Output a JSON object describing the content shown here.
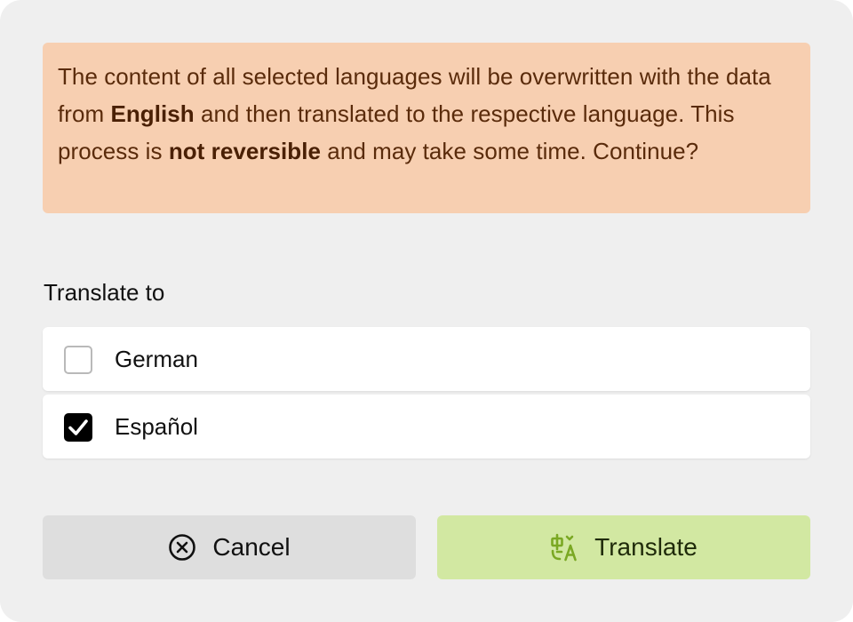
{
  "notice": {
    "part1": "The content of all selected languages will be overwritten with the data from ",
    "source_language": "English",
    "part2": " and then translated to the respective language. This process is ",
    "emphasis": "not reversible",
    "part3": " and may take some time. Continue?"
  },
  "translate_to": {
    "label": "Translate to",
    "languages": [
      {
        "label": "German",
        "checked": false
      },
      {
        "label": "Español",
        "checked": true
      }
    ]
  },
  "buttons": {
    "cancel": {
      "label": "Cancel",
      "icon": "close-circle-icon"
    },
    "translate": {
      "label": "Translate",
      "icon": "translate-icon",
      "icon_color": "#7aa823"
    }
  },
  "colors": {
    "notice_bg": "#f7cfb1",
    "translate_bg": "#d2e8a2",
    "cancel_bg": "#dedede"
  }
}
